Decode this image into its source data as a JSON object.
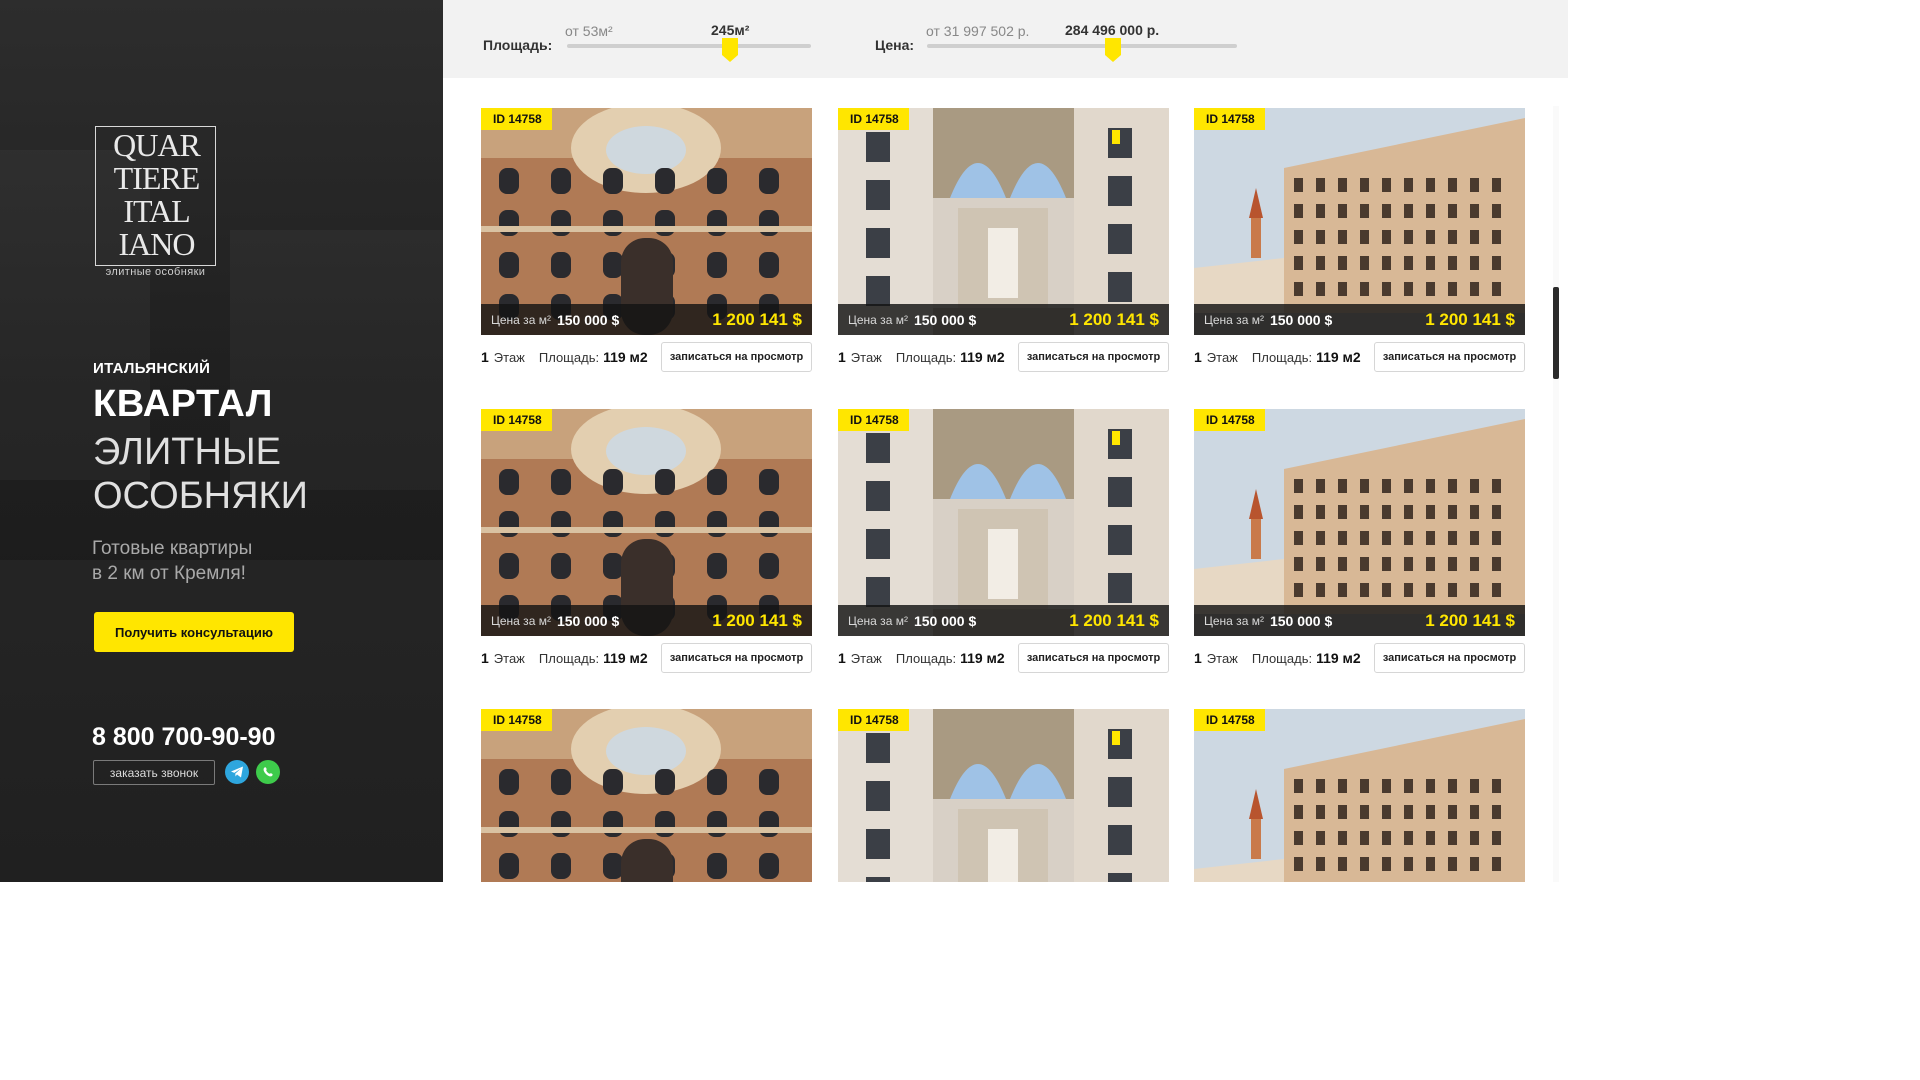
{
  "brand": {
    "logo_lines": [
      "QUAR",
      "TIERE",
      "ITAL",
      "IANO"
    ],
    "tagline": "элитные особняки"
  },
  "hero": {
    "kicker": "ИТАЛЬЯНСКИЙ",
    "title_bold": "КВАРТАЛ",
    "title_line_1": "ЭЛИТНЫЕ",
    "title_line_2": "ОСОБНЯКИ",
    "lead_line_1": "Готовые квартиры",
    "lead_line_2": "в 2 км от Кремля!",
    "cta_label": "Получить консультацию"
  },
  "contacts": {
    "phone": "8 800 700-90-90",
    "callback_label": "заказать звонок",
    "messengers": [
      "telegram-icon",
      "whatsapp-icon"
    ]
  },
  "filters": {
    "area": {
      "label": "Площадь:",
      "min_text": "от 53м²",
      "value_text": "245м²",
      "position": 0.67
    },
    "price": {
      "label": "Цена:",
      "min_text": "от 31 997 502 р.",
      "value_text": "284 496 000 р.",
      "position": 0.6
    }
  },
  "colors": {
    "accent": "#ffe600",
    "dark": "#1f1f1f",
    "filter_bg": "#f2f2f2"
  },
  "listings": [
    {
      "id": "ID 14758",
      "price_label": "Цена за м²",
      "price_per_m2": "150 000 $",
      "total": "1 200 141 $",
      "floor_num": "1",
      "floor_label": "Этаж",
      "area_label": "Площадь:",
      "area_value": "119 м2",
      "button": "записаться на просмотр",
      "photo": "facade"
    },
    {
      "id": "ID 14758",
      "price_label": "Цена за м²",
      "price_per_m2": "150 000 $",
      "total": "1 200 141 $",
      "floor_num": "1",
      "floor_label": "Этаж",
      "area_label": "Площадь:",
      "area_value": "119 м2",
      "button": "записаться на просмотр",
      "photo": "arch"
    },
    {
      "id": "ID 14758",
      "price_label": "Цена за м²",
      "price_per_m2": "150 000 $",
      "total": "1 200 141 $",
      "floor_num": "1",
      "floor_label": "Этаж",
      "area_label": "Площадь:",
      "area_value": "119 м2",
      "button": "записаться на просмотр",
      "photo": "quarter"
    },
    {
      "id": "ID 14758",
      "price_label": "Цена за м²",
      "price_per_m2": "150 000 $",
      "total": "1 200 141 $",
      "floor_num": "1",
      "floor_label": "Этаж",
      "area_label": "Площадь:",
      "area_value": "119 м2",
      "button": "записаться на просмотр",
      "photo": "facade"
    },
    {
      "id": "ID 14758",
      "price_label": "Цена за м²",
      "price_per_m2": "150 000 $",
      "total": "1 200 141 $",
      "floor_num": "1",
      "floor_label": "Этаж",
      "area_label": "Площадь:",
      "area_value": "119 м2",
      "button": "записаться на просмотр",
      "photo": "arch"
    },
    {
      "id": "ID 14758",
      "price_label": "Цена за м²",
      "price_per_m2": "150 000 $",
      "total": "1 200 141 $",
      "floor_num": "1",
      "floor_label": "Этаж",
      "area_label": "Площадь:",
      "area_value": "119 м2",
      "button": "записаться на просмотр",
      "photo": "quarter"
    },
    {
      "id": "ID 14758",
      "photo": "facade"
    },
    {
      "id": "ID 14758",
      "photo": "arch"
    },
    {
      "id": "ID 14758",
      "photo": "quarter"
    }
  ]
}
